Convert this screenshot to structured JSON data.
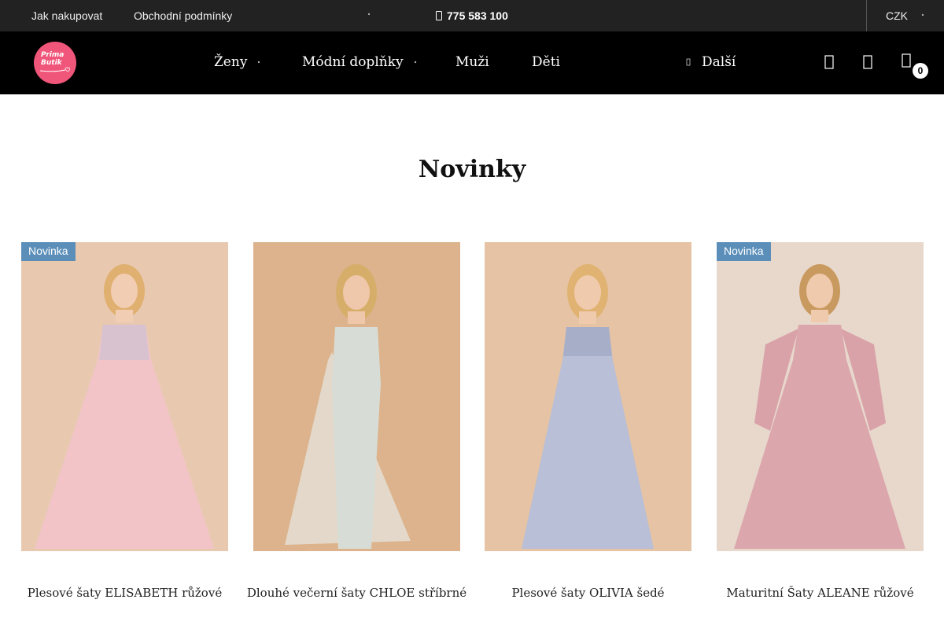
{
  "topbar": {
    "how_to_shop": "Jak nakupovat",
    "terms": "Obchodní podmínky",
    "phone": "775 583 100",
    "currency": "CZK"
  },
  "header": {
    "logo_line1": "Prima",
    "logo_line2": "Butik",
    "nav": [
      {
        "label": "Ženy",
        "has_dropdown": true
      },
      {
        "label": "Módní doplňky",
        "has_dropdown": true
      },
      {
        "label": "Muži",
        "has_dropdown": false
      },
      {
        "label": "Děti",
        "has_dropdown": false
      },
      {
        "label": "Další",
        "has_dropdown": false
      }
    ],
    "icons": [
      "search-icon",
      "user-icon",
      "cart-icon"
    ],
    "cart_count": "0"
  },
  "main": {
    "title": "Novinky",
    "products": [
      {
        "name": "Plesové šaty ELISABETH růžové",
        "badge": "Novinka",
        "dress_color": "#f2c4c8",
        "bg": "#e8c9b0"
      },
      {
        "name": "Dlouhé večerní šaty CHLOE stříbrné",
        "badge": "",
        "dress_color": "#d7ddd6",
        "bg": "#dcb38c"
      },
      {
        "name": "Plesové šaty OLIVIA šedé",
        "badge": "",
        "dress_color": "#b8bfd6",
        "bg": "#e6c3a4"
      },
      {
        "name": "Maturitní Šaty ALEANE růžové",
        "badge": "Novinka",
        "dress_color": "#dba6ac",
        "bg": "#e8d8cc"
      }
    ]
  },
  "colors": {
    "topbar_bg": "#222222",
    "header_bg": "#000000",
    "logo_pink": "#f0567a",
    "badge_blue": "#5b8fb9"
  }
}
